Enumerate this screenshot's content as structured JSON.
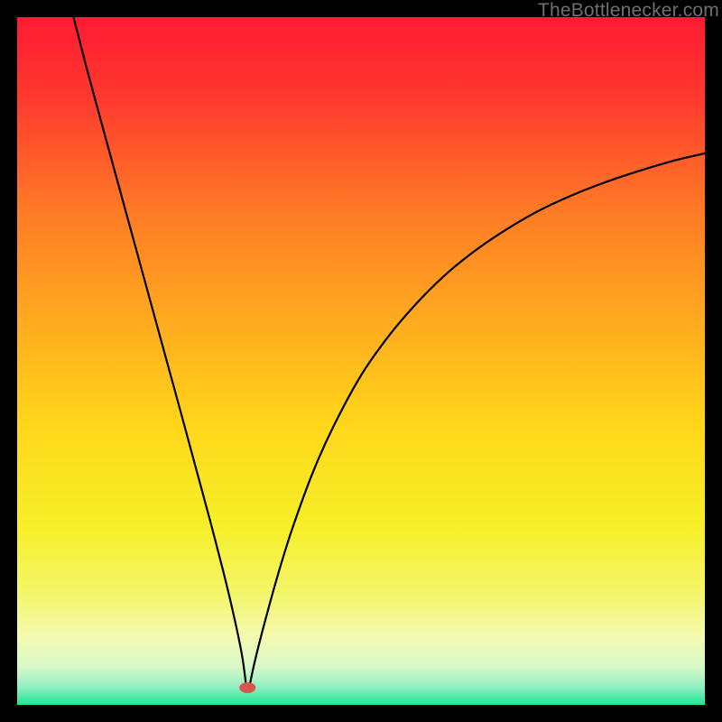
{
  "watermark": {
    "text": "TheBottlenecker.com"
  },
  "chart_data": {
    "type": "line",
    "title": "",
    "xlabel": "",
    "ylabel": "",
    "xlim": [
      0,
      100
    ],
    "ylim": [
      0,
      100
    ],
    "background_gradient": {
      "stops": [
        {
          "offset": 0.0,
          "color": "#ff1a33"
        },
        {
          "offset": 0.12,
          "color": "#ff3a2e"
        },
        {
          "offset": 0.28,
          "color": "#ff7a26"
        },
        {
          "offset": 0.44,
          "color": "#ffaa1f"
        },
        {
          "offset": 0.6,
          "color": "#ffd81a"
        },
        {
          "offset": 0.74,
          "color": "#f7ef28"
        },
        {
          "offset": 0.84,
          "color": "#f3f66a"
        },
        {
          "offset": 0.9,
          "color": "#f4fab0"
        },
        {
          "offset": 0.945,
          "color": "#d8f8c8"
        },
        {
          "offset": 0.975,
          "color": "#8feec0"
        },
        {
          "offset": 1.0,
          "color": "#19e892"
        }
      ]
    },
    "marker": {
      "x": 33.5,
      "y": 2.5,
      "color": "#d8564c"
    },
    "series": [
      {
        "name": "left-branch",
        "x": [
          8.2,
          10,
          12,
          14,
          16,
          18,
          20,
          22,
          24,
          26,
          28,
          30,
          31.5,
          32.7,
          33.3
        ],
        "y": [
          100,
          93,
          85.6,
          78.3,
          71,
          63.7,
          56.4,
          49.1,
          41.8,
          34.4,
          27,
          19.3,
          13,
          7.2,
          2.8
        ]
      },
      {
        "name": "right-branch",
        "x": [
          33.8,
          34.6,
          36,
          38,
          40,
          43,
          46,
          50,
          54,
          58,
          62,
          66,
          70,
          75,
          80,
          85,
          90,
          95,
          100
        ],
        "y": [
          2.8,
          6.5,
          12,
          19.2,
          25.6,
          33.8,
          40.5,
          47.9,
          53.6,
          58.3,
          62.3,
          65.6,
          68.4,
          71.4,
          73.8,
          75.8,
          77.5,
          79,
          80.2
        ]
      }
    ]
  }
}
